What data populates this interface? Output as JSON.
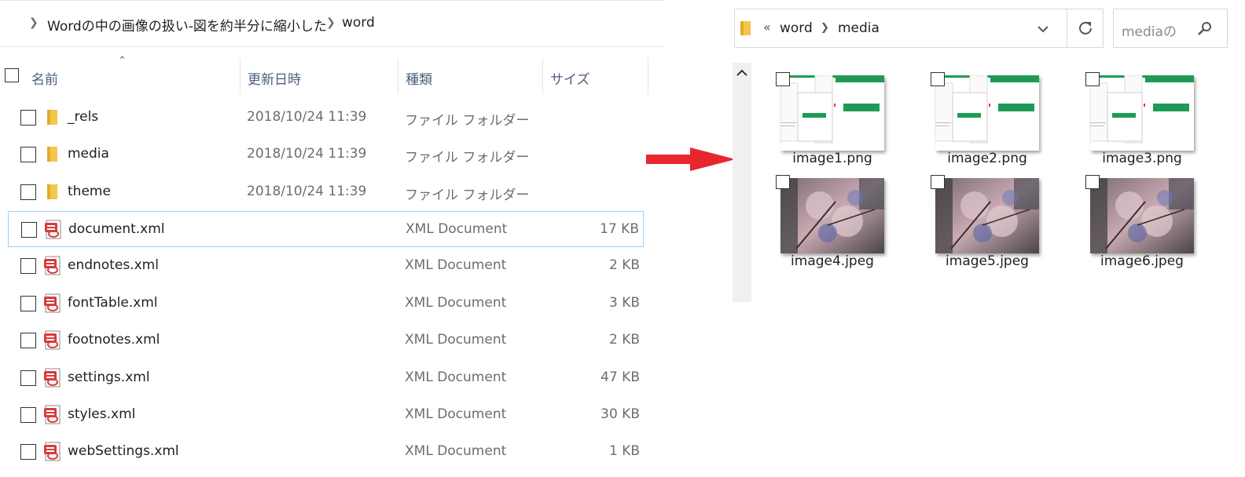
{
  "left": {
    "breadcrumb": {
      "segment1": "Wordの中の画像の扱い-図を約半分に縮小した",
      "segment2": "word"
    },
    "columns": {
      "name": "名前",
      "date": "更新日時",
      "type": "種類",
      "size": "サイズ"
    },
    "rows": [
      {
        "name": "_rels",
        "date": "2018/10/24 11:39",
        "type": "ファイル フォルダー",
        "size": "",
        "icon": "folder-icon"
      },
      {
        "name": "media",
        "date": "2018/10/24 11:39",
        "type": "ファイル フォルダー",
        "size": "",
        "icon": "folder-icon"
      },
      {
        "name": "theme",
        "date": "2018/10/24 11:39",
        "type": "ファイル フォルダー",
        "size": "",
        "icon": "folder-icon"
      },
      {
        "name": "document.xml",
        "date": "",
        "type": "XML Document",
        "size": "17 KB",
        "icon": "xml-file-icon"
      },
      {
        "name": "endnotes.xml",
        "date": "",
        "type": "XML Document",
        "size": "2 KB",
        "icon": "xml-file-icon"
      },
      {
        "name": "fontTable.xml",
        "date": "",
        "type": "XML Document",
        "size": "3 KB",
        "icon": "xml-file-icon"
      },
      {
        "name": "footnotes.xml",
        "date": "",
        "type": "XML Document",
        "size": "2 KB",
        "icon": "xml-file-icon"
      },
      {
        "name": "settings.xml",
        "date": "",
        "type": "XML Document",
        "size": "47 KB",
        "icon": "xml-file-icon"
      },
      {
        "name": "styles.xml",
        "date": "",
        "type": "XML Document",
        "size": "30 KB",
        "icon": "xml-file-icon"
      },
      {
        "name": "webSettings.xml",
        "date": "",
        "type": "XML Document",
        "size": "1 KB",
        "icon": "xml-file-icon"
      }
    ]
  },
  "right": {
    "address": {
      "overflow": "«",
      "segment1": "word",
      "segment2": "media"
    },
    "search_placeholder": "mediaの",
    "files": [
      {
        "name": "image1.png",
        "kind": "document-thumbnail"
      },
      {
        "name": "image2.png",
        "kind": "document-thumbnail"
      },
      {
        "name": "image3.png",
        "kind": "document-thumbnail"
      },
      {
        "name": "image4.jpeg",
        "kind": "photo-thumbnail"
      },
      {
        "name": "image5.jpeg",
        "kind": "photo-thumbnail"
      },
      {
        "name": "image6.jpeg",
        "kind": "photo-thumbnail"
      }
    ]
  },
  "colors": {
    "arrow": "#e8262d",
    "selection_border": "#99d1ff",
    "folder": "#f4c64e",
    "xml_icon": "#d83b3b",
    "brand_green": "#1e9a55"
  }
}
